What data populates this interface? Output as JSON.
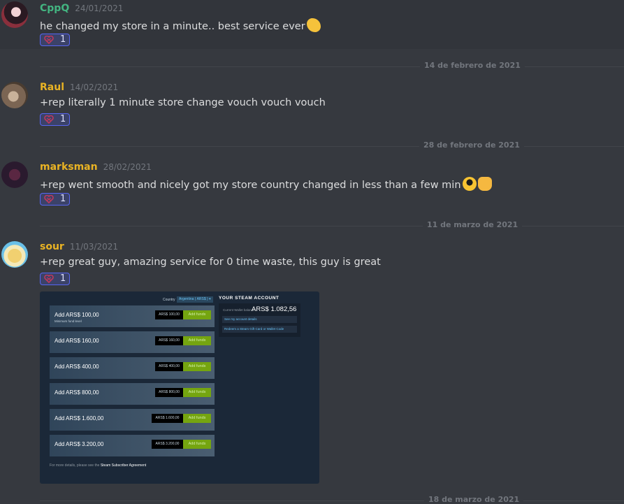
{
  "messages": [
    {
      "username": "CppQ",
      "timestamp": "24/01/2021",
      "text": "he changed my store in a minute..  best service ever",
      "reaction_count": "1",
      "name_color": "#43b581"
    },
    {
      "username": "Raul",
      "timestamp": "14/02/2021",
      "text": "+rep literally 1 minute store change vouch vouch vouch",
      "reaction_count": "1",
      "name_color": "#e9b324"
    },
    {
      "username": "marksman",
      "timestamp": "28/02/2021",
      "text": "+rep went smooth and nicely got my store country changed in less than a few min",
      "reaction_count": "1",
      "name_color": "#e9b324"
    },
    {
      "username": "sour",
      "timestamp": "11/03/2021",
      "text": "+rep great guy, amazing service for 0 time waste, this guy is great",
      "reaction_count": "1",
      "name_color": "#e9b324"
    }
  ],
  "dividers": [
    "14 de febrero de 2021",
    "28 de febrero de 2021",
    "11 de marzo de 2021",
    "18 de marzo de 2021"
  ],
  "reaction_icon": "heart-cross-icon",
  "steam": {
    "country_label": "Country",
    "country_value": "Argentina ( ARS$ )",
    "rows": [
      {
        "label": "Add ARS$ 100,00",
        "sub": "Minimum fund level",
        "price": "ARS$ 100,00",
        "button": "Add funds"
      },
      {
        "label": "Add ARS$ 160,00",
        "price": "ARS$ 160,00",
        "button": "Add funds"
      },
      {
        "label": "Add ARS$ 400,00",
        "price": "ARS$ 400,00",
        "button": "Add funds"
      },
      {
        "label": "Add ARS$ 800,00",
        "price": "ARS$ 800,00",
        "button": "Add funds"
      },
      {
        "label": "Add ARS$ 1.600,00",
        "price": "ARS$ 1.600,00",
        "button": "Add funds"
      },
      {
        "label": "Add ARS$ 3.200,00",
        "price": "ARS$ 3.200,00",
        "button": "Add funds"
      }
    ],
    "account_title": "YOUR STEAM ACCOUNT",
    "balance_label": "Current Wallet balance",
    "balance_value": "ARS$ 1.082,56",
    "link_account": "See my account details",
    "link_redeem": "Redeem a Steam Gift Card or Wallet Code",
    "footer_prefix": "For more details, please see the",
    "footer_link": "Steam Subscriber Agreement"
  },
  "colors": {
    "background": "#36393f",
    "reaction_bg": "#3b4269",
    "reaction_border": "#5865f2",
    "steam_green": "#75a510"
  }
}
